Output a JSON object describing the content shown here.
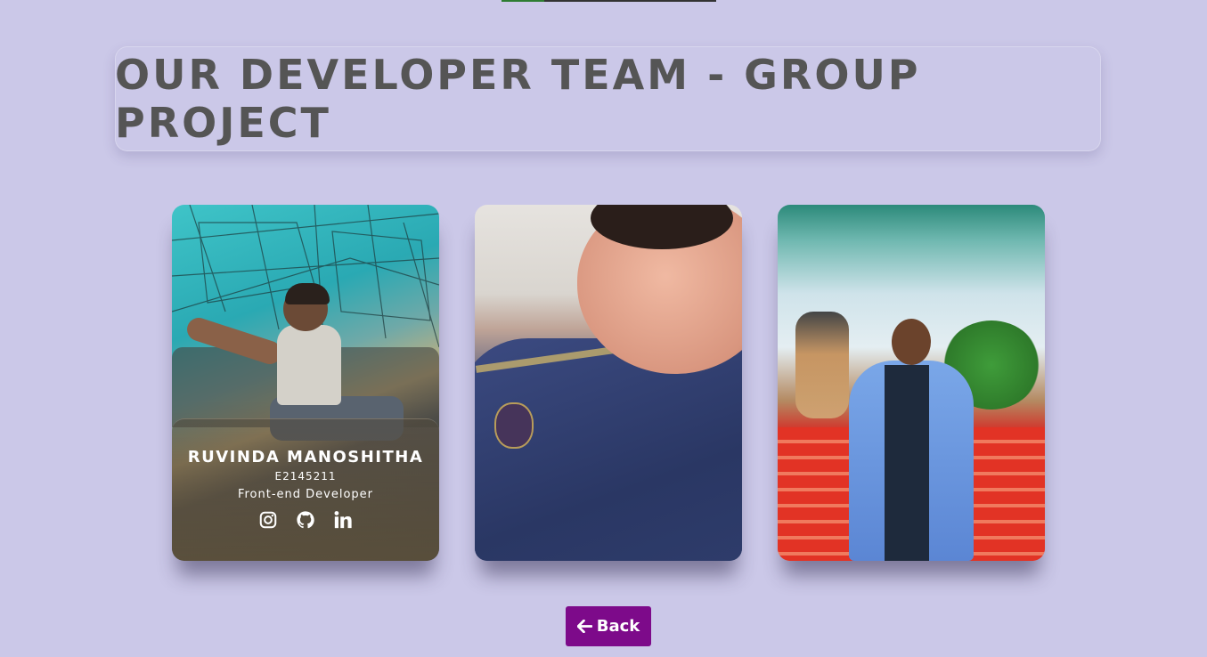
{
  "page": {
    "title": "OUR DEVELOPER TEAM - GROUP PROJECT"
  },
  "members": [
    {
      "name": "RUVINDA MANOSHITHA",
      "student_id": "E2145211",
      "role": "Front-end Developer",
      "socials": [
        "instagram-icon",
        "github-icon",
        "linkedin-icon"
      ]
    },
    {
      "name": "",
      "student_id": "",
      "role": ""
    },
    {
      "name": "",
      "student_id": "",
      "role": ""
    }
  ],
  "back_button": {
    "icon": "arrow-left-icon",
    "label": "Back"
  },
  "colors": {
    "background": "#cbc8e8",
    "title_text": "#555555",
    "back_button": "#7d0a8a"
  }
}
